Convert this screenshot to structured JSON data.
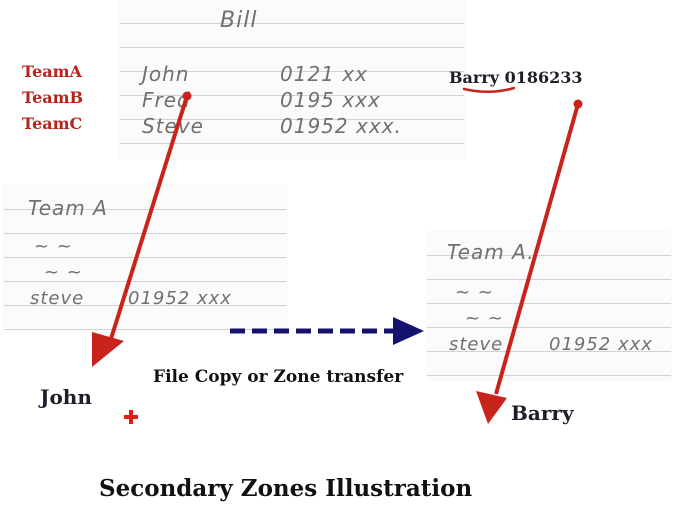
{
  "top_sheet": {
    "heading": "Bill",
    "rows": [
      {
        "name": "John",
        "number": "0121 xx"
      },
      {
        "name": "Fred",
        "number": "0195 xxx"
      },
      {
        "name": "Steve",
        "number": "01952 xxx."
      }
    ]
  },
  "teams": [
    "TeamA",
    "TeamB",
    "TeamC"
  ],
  "barry_entry": {
    "name": "Barry",
    "number": "0186233"
  },
  "left_sheet": {
    "heading": "Team A",
    "ditto_1": "~ ~",
    "ditto_2": "~ ~",
    "entry_name": "steve",
    "entry_number": "01952 xxx"
  },
  "right_sheet": {
    "heading": "Team A.",
    "ditto_1": "~ ~",
    "ditto_2": "~ ~",
    "entry_name": "steve",
    "entry_number": "01952 xxx"
  },
  "labels": {
    "john": "John",
    "barry": "Barry",
    "transfer": "File Copy or Zone transfer",
    "title": "Secondary Zones Illustration"
  },
  "colors": {
    "arrow_red": "#c8241c",
    "arrow_blue": "#15126e",
    "team_text": "#b8231b"
  }
}
